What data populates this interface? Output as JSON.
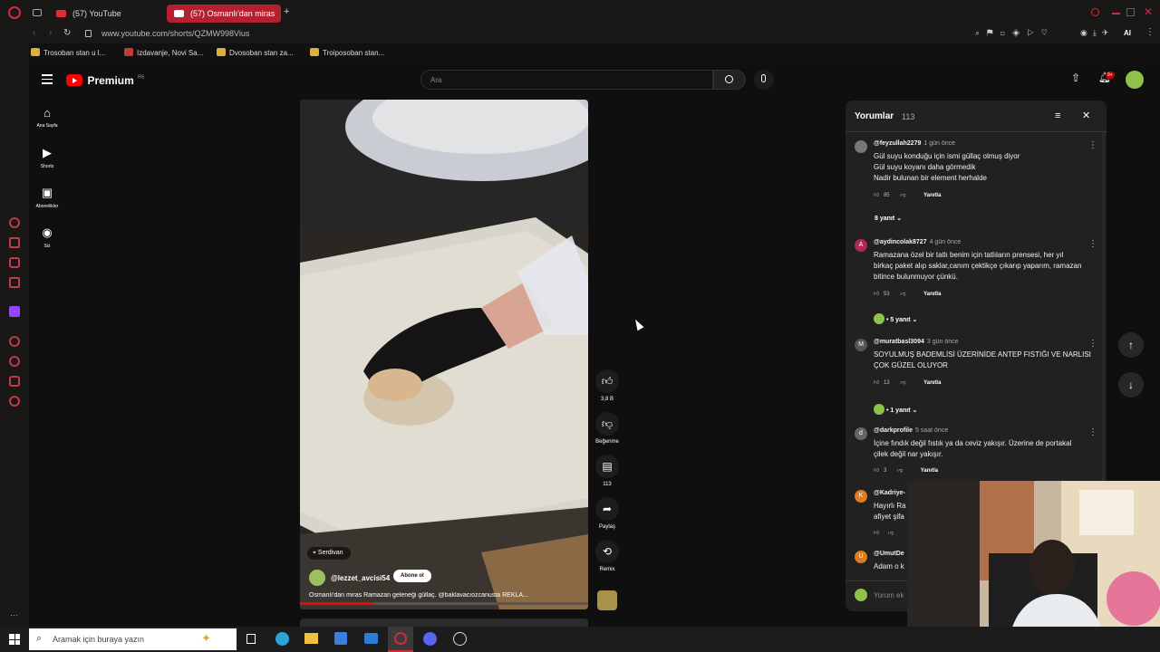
{
  "browser": {
    "tabs": [
      {
        "label": "(57) YouTube"
      },
      {
        "label": "(57) Osmanlı'dan miras"
      }
    ],
    "url": "www.youtube.com/shorts/QZMW998Vius",
    "bookmarks": [
      "Trosoban stan u l...",
      "Izdavanje, Novi Sa...",
      "Dvosoban stan za...",
      "Troiposoban stan..."
    ],
    "ai_label": "AI"
  },
  "youtube": {
    "logo_text": "Premium",
    "logo_badge": "RS",
    "search_placeholder": "Ara",
    "notif_count": "9+",
    "nav": [
      {
        "label": "Ana Sayfa",
        "icon": "home-icon"
      },
      {
        "label": "Shorts",
        "icon": "shorts-icon"
      },
      {
        "label": "Abonelikler",
        "icon": "subscriptions-icon"
      },
      {
        "label": "Siz",
        "icon": "you-icon"
      }
    ],
    "video": {
      "location": "Serdivan",
      "channel": "@lezzet_avcisi54",
      "subscribe": "Abone ol",
      "description": "Osmanlı'dan miras Ramazan geleneği güllaç. @baklavacıozcanusta REKLA..."
    },
    "actions": [
      {
        "label": "3,8 B",
        "icon": "like-icon"
      },
      {
        "label": "Beğenme",
        "icon": "dislike-icon"
      },
      {
        "label": "113",
        "icon": "comment-icon"
      },
      {
        "label": "Paylaş",
        "icon": "share-icon"
      },
      {
        "label": "Remix",
        "icon": "remix-icon"
      }
    ],
    "comments": {
      "title": "Yorumlar",
      "count": "113",
      "input_placeholder": "Yorum ek",
      "reply_label": "Yanıtla",
      "items": [
        {
          "handle": "@feyzullah2279",
          "time": "1 gün önce",
          "avatar": "",
          "avatar_color": "#777777",
          "body": [
            "Gül suyu konduğu için ismi güllaç olmuş diyor",
            "Gül suyu koyanı daha görmedik",
            "Nadir bulunan bir element herhalde"
          ],
          "likes": "85",
          "replies": "8 yanıt"
        },
        {
          "handle": "@aydincolak8727",
          "time": "4 gün önce",
          "avatar": "A",
          "avatar_color": "#b0285a",
          "body": [
            "Ramazana özel bir tatlı benim için tatlıların prensesi, her yıl",
            "birkaç paket alıp saklar,canım çektikçe  çıkarıp yaparım, ramazan",
            "bitince bulunmuyor çünkü."
          ],
          "likes": "53",
          "replies": "• 5 yanıt"
        },
        {
          "handle": "@muratbasl3094",
          "time": "3 gün önce",
          "avatar": "M",
          "avatar_color": "#555555",
          "body": [
            "SOYULMUŞ BADEMLİSİ ÜZERİNİDE ANTEP FISTIĞI VE NARLISI",
            "ÇOK GÜZEL OLUYOR"
          ],
          "likes": "13",
          "replies": "• 1 yanıt"
        },
        {
          "handle": "@darkprofile",
          "time": "5 saat önce",
          "avatar": "d",
          "avatar_color": "#666666",
          "body": [
            "İçine fındık değil fıstık ya da ceviz yakışır. Üzerine de portakal",
            "çilek değil nar yakışır."
          ],
          "likes": "3",
          "replies": ""
        },
        {
          "handle": "@Kadriye-",
          "time": "",
          "avatar": "K",
          "avatar_color": "#e07b1f",
          "body": [
            "Hayırlı Ra",
            "afiyet şifa"
          ],
          "likes": "",
          "replies": ""
        },
        {
          "handle": "@UmutDe",
          "time": "",
          "avatar": "U",
          "avatar_color": "#e07b1f",
          "body": [
            "Adam o k"
          ],
          "likes": "",
          "replies": ""
        }
      ]
    }
  },
  "taskbar": {
    "search_placeholder": "Aramak için buraya yazın"
  },
  "colors": {
    "accent": "#ff0000",
    "background": "#0f0f0f",
    "panel": "#212121"
  }
}
